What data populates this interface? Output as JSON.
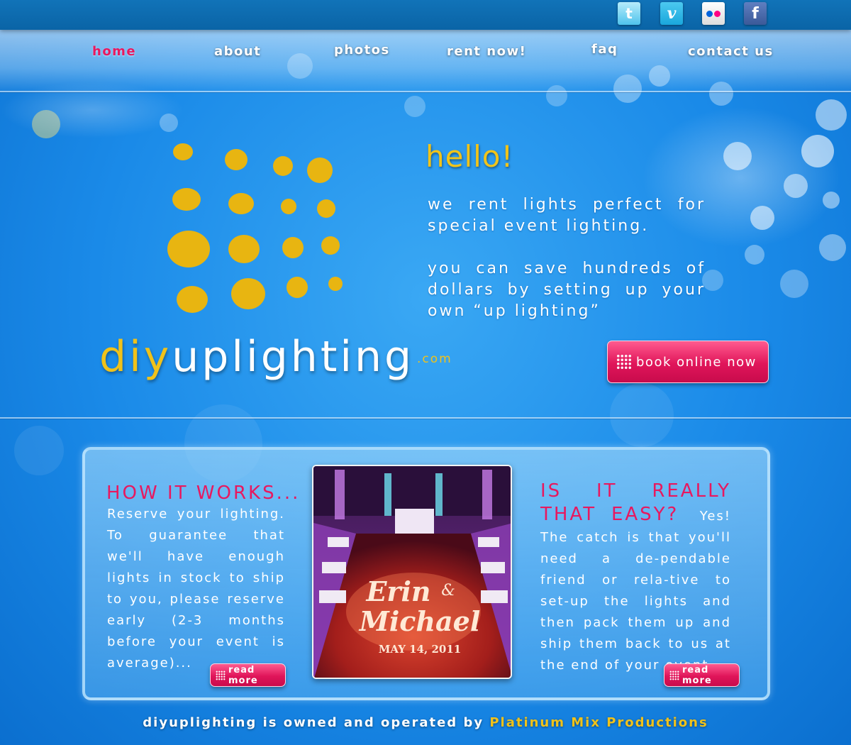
{
  "colors": {
    "pink": "#e8185f",
    "gold": "#f0c21a",
    "sky": "#1a8ae8"
  },
  "social": [
    {
      "name": "twitter",
      "label": "t"
    },
    {
      "name": "vimeo",
      "label": "v"
    },
    {
      "name": "flickr",
      "label": ""
    },
    {
      "name": "facebook",
      "label": "f"
    }
  ],
  "nav": {
    "home": "home",
    "about": "about",
    "photos": "photos",
    "rent": "rent now!",
    "faq": "faq",
    "contact": "contact us"
  },
  "hero": {
    "hello": "hello!",
    "intro1": "we rent lights perfect for special event lighting.",
    "intro2": "you can save hundreds of dollars by setting up your own “up lighting”",
    "brand_diy": "diy",
    "brand_rest": "uplighting",
    "brand_com": ".com",
    "book_label": "book online now"
  },
  "how": {
    "title": "HOW IT WORKS...",
    "text": "Reserve your lighting. To guarantee that we'll have enough lights in stock to ship to you, please reserve early (2-3 months before your event is average)...",
    "read_more": "read more"
  },
  "photo": {
    "line1": "Erin",
    "amp": "&",
    "line2": "Michael",
    "date": "MAY 14, 2011"
  },
  "easy": {
    "title": "IS IT REALLY THAT EASY?",
    "text": "Yes! The catch is that you'll need a de-pendable friend or rela-tive to set-up the lights and then pack them up and ship them back to us at the end of your event.",
    "read_more": "read more"
  },
  "footer": {
    "text": "diyuplighting is owned and operated by ",
    "link": "Platinum Mix Productions"
  }
}
